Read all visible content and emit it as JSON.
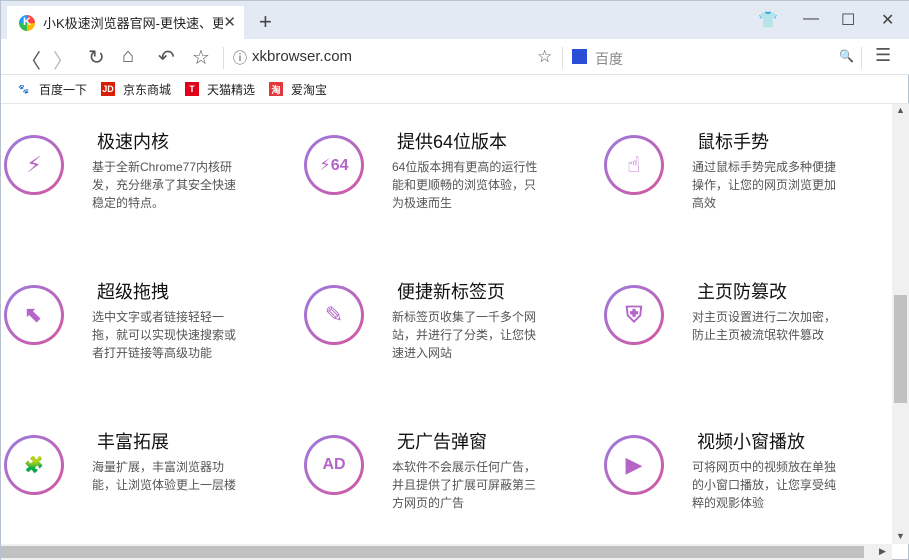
{
  "tab": {
    "title": "小K极速浏览器官网-更快速、更稳定",
    "close": "✕",
    "new": "+"
  },
  "window": {
    "skin": "👕",
    "min": "—",
    "max": "☐",
    "close": "✕"
  },
  "nav": {
    "back": "〈",
    "forward": "〉",
    "reload": "↻",
    "home": "⌂",
    "undo": "↶",
    "fav": "☆",
    "info": "ⓘ",
    "url": "xkbrowser.com",
    "star": "☆",
    "search_engine": "百度",
    "search": "🔍",
    "menu": "☰"
  },
  "bookmarks": [
    {
      "label": "百度一下",
      "icon": "baidu-icon",
      "color": "#2f6fe0",
      "glyph": "🐾"
    },
    {
      "label": "京东商城",
      "icon": "jd-icon",
      "color": "#d81e06",
      "glyph": "JD"
    },
    {
      "label": "天猫精选",
      "icon": "tmall-icon",
      "color": "#e1001a",
      "glyph": "T"
    },
    {
      "label": "爱淘宝",
      "icon": "taobao-icon",
      "color": "#e4393c",
      "glyph": "淘"
    }
  ],
  "features": [
    {
      "title": "极速内核",
      "desc": "基于全新Chrome77内核研发，充分继承了其安全快速稳定的特点。",
      "icon": "chip-icon",
      "glyph": "⚡"
    },
    {
      "title": "提供64位版本",
      "desc": "64位版本拥有更高的运行性能和更顺畅的浏览体验，只为极速而生",
      "icon": "64bit-icon",
      "glyph": "⚡64"
    },
    {
      "title": "鼠标手势",
      "desc": "通过鼠标手势完成多种便捷操作，让您的网页浏览更加高效",
      "icon": "hand-gesture-icon",
      "glyph": "☝"
    },
    {
      "title": "超级拖拽",
      "desc": "选中文字或者链接轻轻一拖，就可以实现快速搜索或者打开链接等高级功能",
      "icon": "drag-cursor-icon",
      "glyph": "⬉"
    },
    {
      "title": "便捷新标签页",
      "desc": "新标签页收集了一千多个网站，并进行了分类，让您快速进入网站",
      "icon": "new-tab-icon",
      "glyph": "✎"
    },
    {
      "title": "主页防篡改",
      "desc": "对主页设置进行二次加密，防止主页被流氓软件篡改",
      "icon": "shield-icon",
      "glyph": "⛨"
    },
    {
      "title": "丰富拓展",
      "desc": "海量扩展，丰富浏览器功能，让浏览体验更上一层楼",
      "icon": "puzzle-icon",
      "glyph": "🧩"
    },
    {
      "title": "无广告弹窗",
      "desc": "本软件不会展示任何广告，并且提供了扩展可屏蔽第三方网页的广告",
      "icon": "no-ad-icon",
      "glyph": "AD"
    },
    {
      "title": "视频小窗播放",
      "desc": "可将网页中的视频放在单独的小窗口播放，让您享受纯粹的观影体验",
      "icon": "video-icon",
      "glyph": "▶"
    }
  ]
}
